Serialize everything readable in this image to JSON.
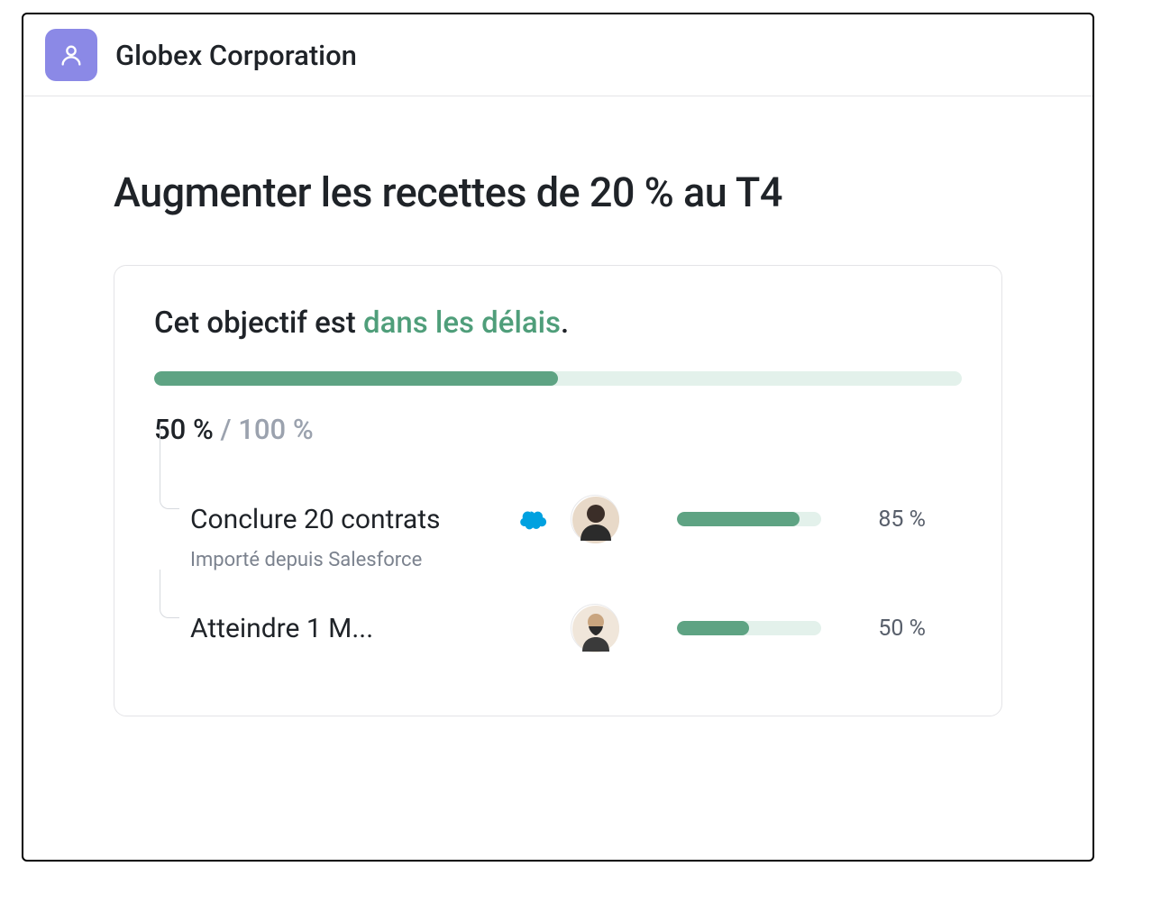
{
  "header": {
    "title": "Globex Corporation"
  },
  "page": {
    "title": "Augmenter les recettes de 20 % au T4"
  },
  "goal": {
    "status_prefix": "Cet objectif est ",
    "status_highlight": "dans les délais",
    "status_suffix": ".",
    "progress_percent": 50,
    "current_label": "50 %",
    "separator": " / ",
    "total_label": "100 %"
  },
  "sub_goals": [
    {
      "title": "Conclure 20 contrats",
      "note": "Importé depuis Salesforce",
      "has_salesforce": true,
      "percent": 85,
      "percent_label": "85 %"
    },
    {
      "title": "Atteindre 1 M...",
      "note": "",
      "has_salesforce": false,
      "percent": 50,
      "percent_label": "50 %"
    }
  ],
  "colors": {
    "accent_green": "#5ea383",
    "accent_green_light": "#e3f1eb",
    "header_icon_bg": "#8b89e6"
  }
}
